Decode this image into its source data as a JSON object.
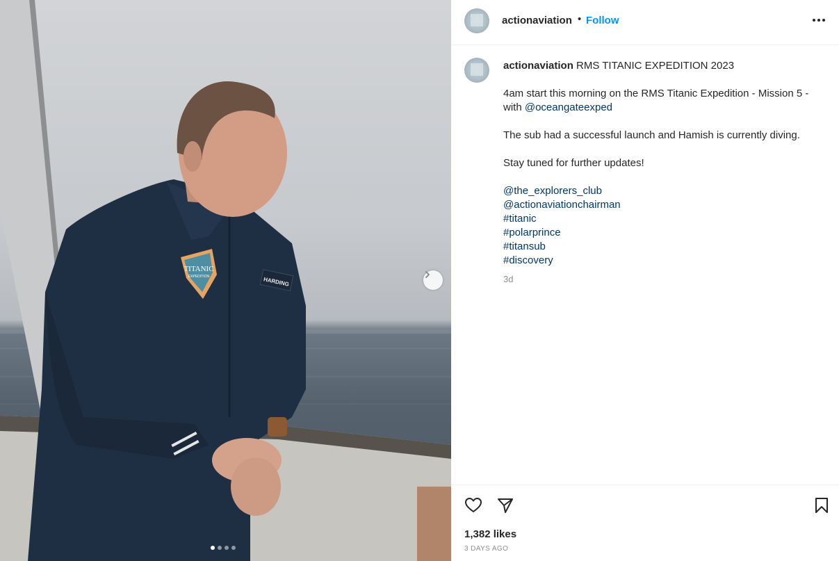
{
  "post": {
    "username": "actionaviation",
    "follow_label": "Follow",
    "header_separator": "•",
    "caption": {
      "title": "RMS TITANIC EXPEDITION 2023",
      "line1": "4am start this morning on the RMS Titanic Expedition - Mission 5 - with ",
      "mention_oceangate": "@oceangateexped",
      "line2": "The sub had a successful launch and Hamish is currently diving.",
      "line3": "Stay tuned for further updates!",
      "tags": [
        "@the_explorers_club",
        "@actionaviationchairman",
        "#titanic",
        "#polarprince",
        "#titansub",
        "#discovery"
      ],
      "time": "3d"
    },
    "likes": "1,382 likes",
    "posted_ago": "3 DAYS AGO"
  },
  "media": {
    "patch_text": "TITANIC",
    "patch_subtext": "EXPEDITION",
    "name_tag": "HARDING",
    "carousel_count": 4,
    "carousel_active": 0
  },
  "icons": {
    "like": "heart-icon",
    "share": "paper-plane-icon",
    "save": "bookmark-icon",
    "more": "more-options-icon",
    "next": "chevron-right-icon"
  }
}
